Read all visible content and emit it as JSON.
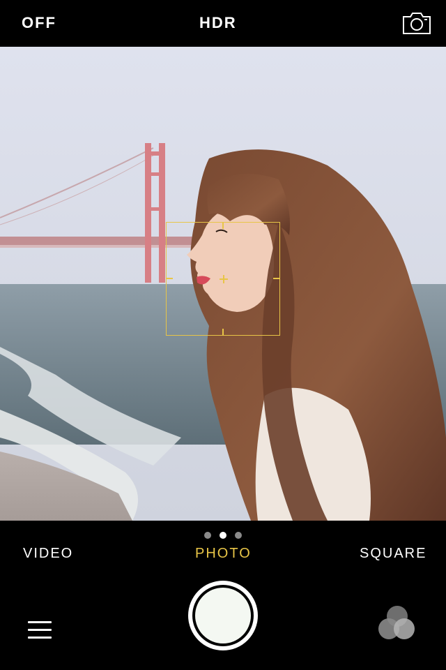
{
  "top_bar": {
    "flash_label": "OFF",
    "hdr_label": "HDR",
    "switch_camera_icon": "camera-switch-icon"
  },
  "viewfinder": {
    "scene": "photo-preview",
    "focus_box_icon": "focus-reticle-icon",
    "accent_color": "#e8c547"
  },
  "mode_bar": {
    "page_dots": 3,
    "active_dot": 1,
    "modes": [
      {
        "label": "VIDEO",
        "active": false
      },
      {
        "label": "PHOTO",
        "active": true
      },
      {
        "label": "SQUARE",
        "active": false
      }
    ]
  },
  "controls": {
    "menu_icon": "hamburger-menu-icon",
    "shutter_icon": "shutter-button-icon",
    "filters_icon": "filters-icon"
  }
}
